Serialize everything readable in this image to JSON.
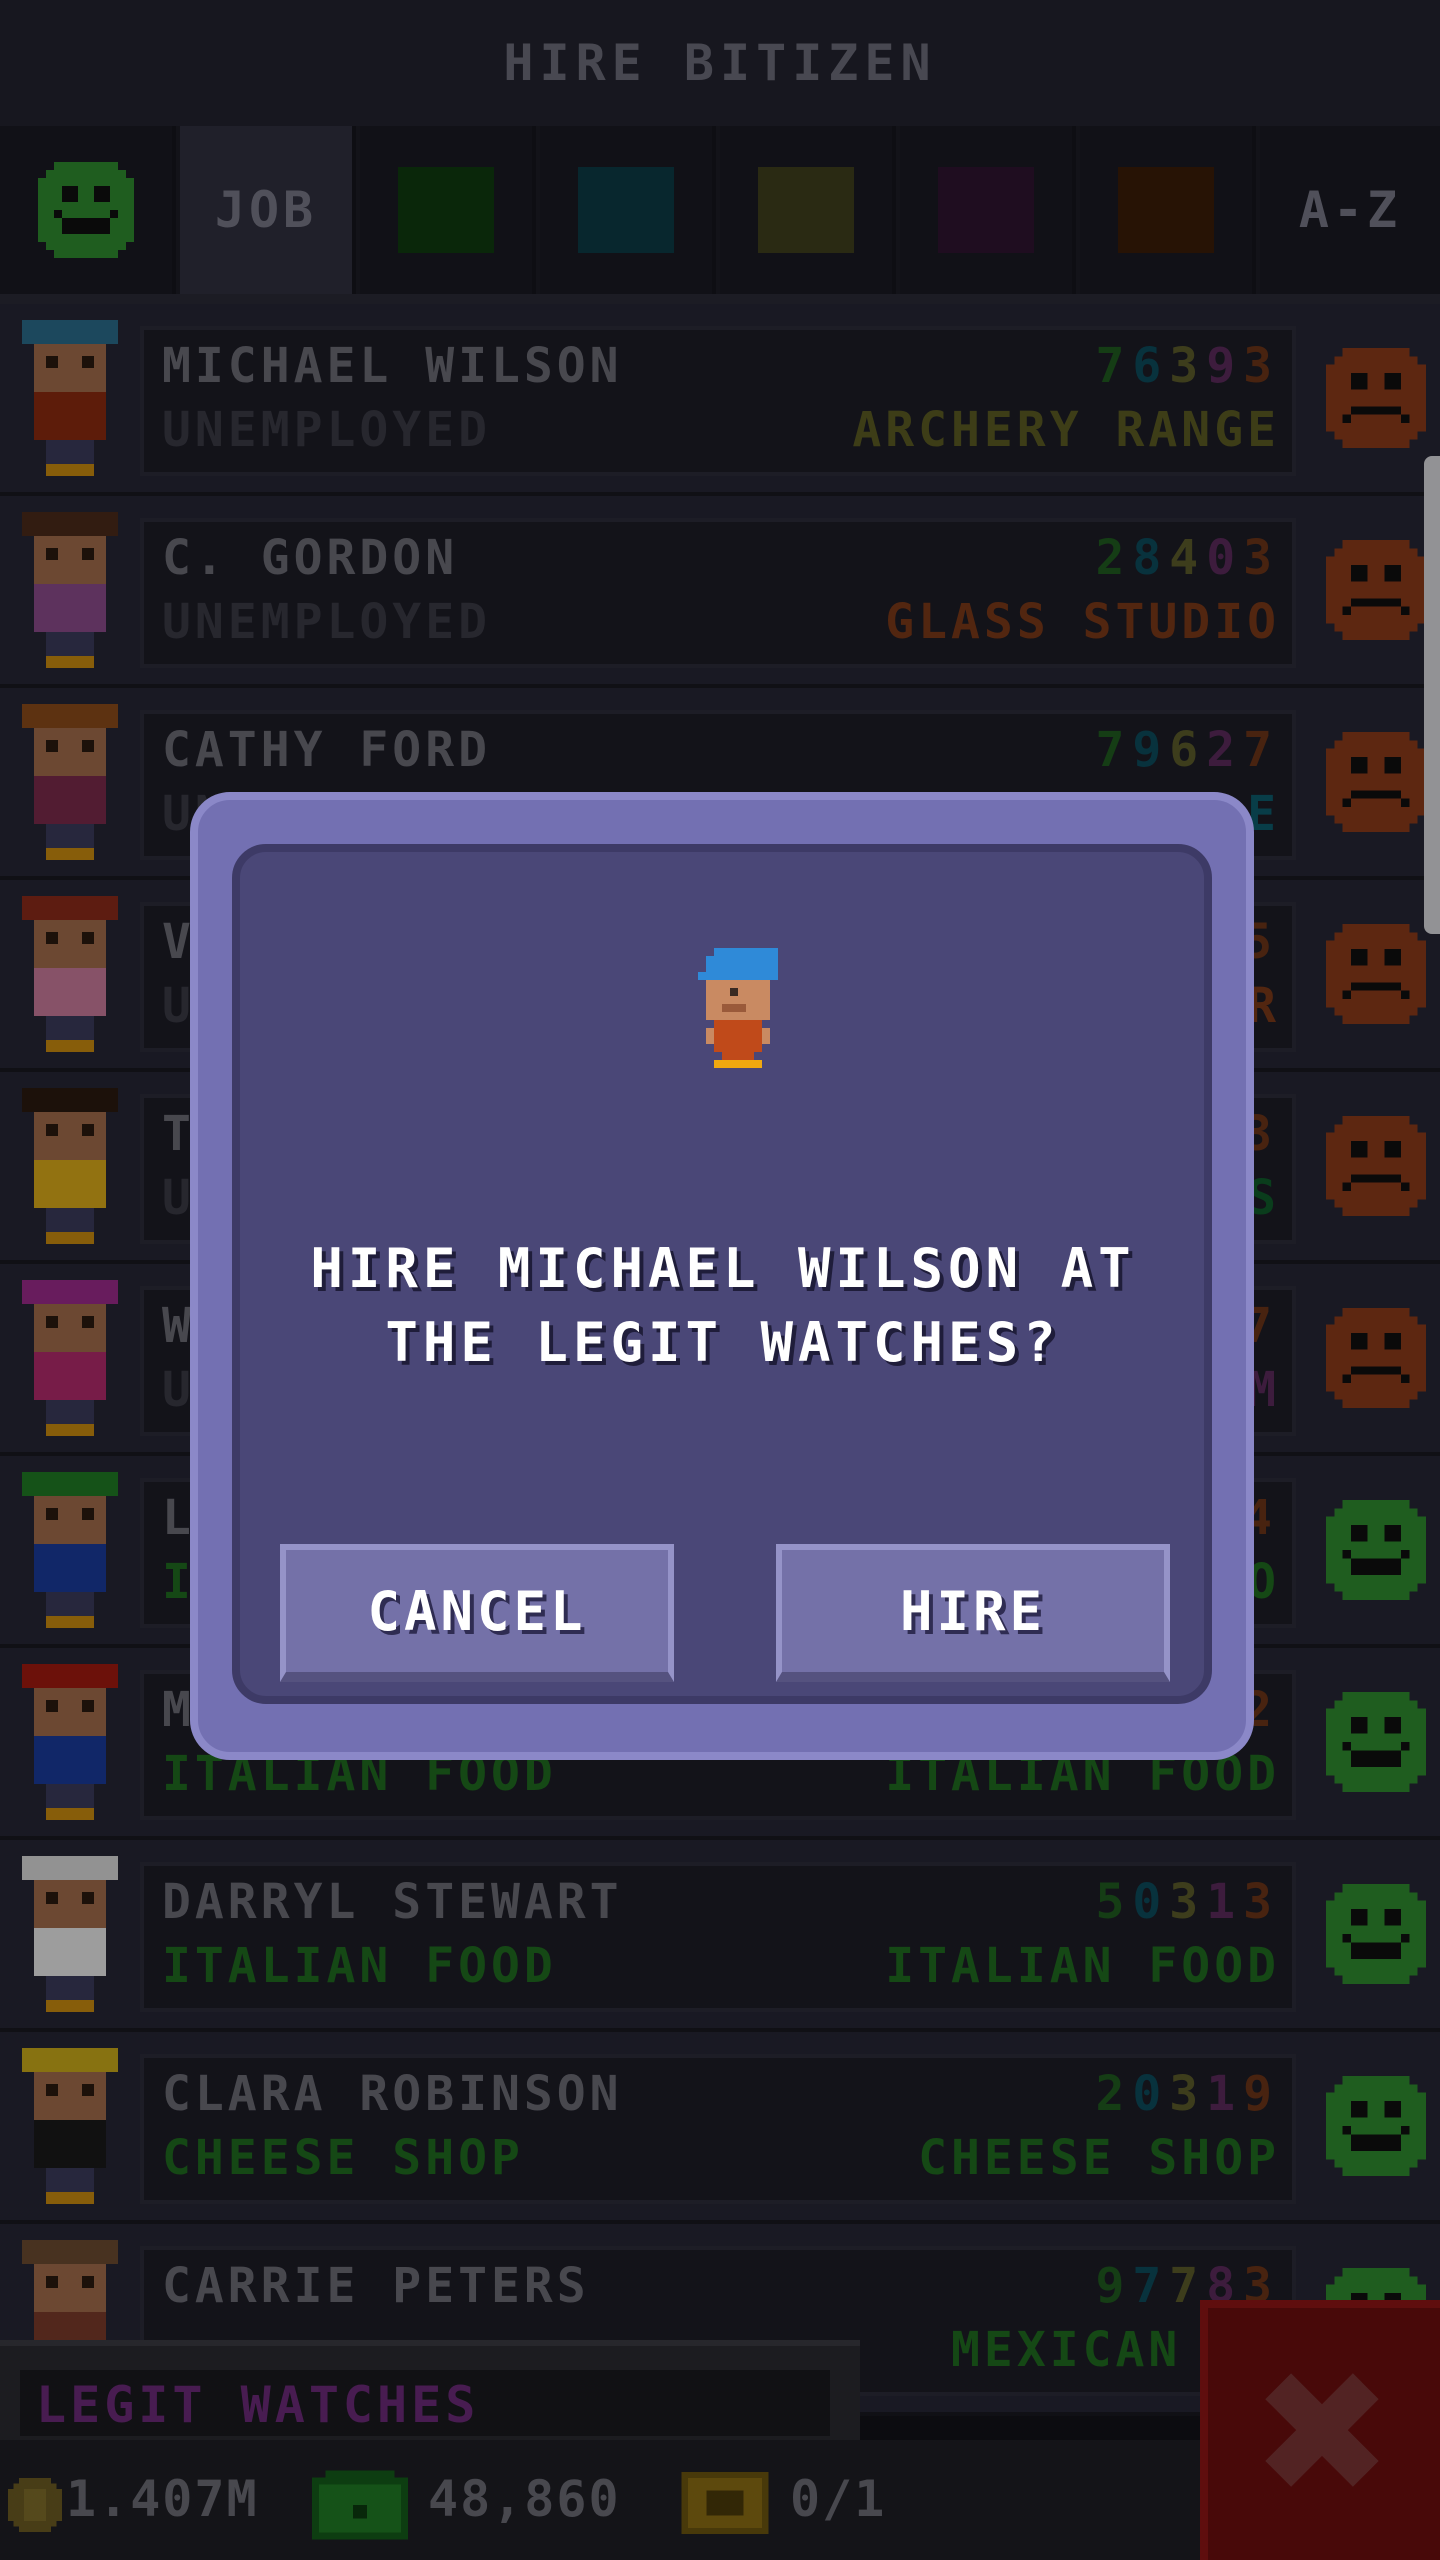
{
  "header": {
    "title": "HIRE BITIZEN"
  },
  "tabs": {
    "job_label": "JOB",
    "az_label": "A-Z",
    "colors": [
      "#0f3a0f",
      "#0c3a44",
      "#3e3e1c",
      "#2f1430",
      "#3a1c08"
    ]
  },
  "rows": [
    {
      "name": "MICHAEL WILSON",
      "job": "UNEMPLOYED",
      "dream": "ARCHERY RANGE",
      "stats": [
        "7",
        "6",
        "3",
        "9",
        "3"
      ],
      "job_color": "#3a3a44",
      "dream_color": "#5a5a22",
      "mood": "sad"
    },
    {
      "name": "C. GORDON",
      "job": "UNEMPLOYED",
      "dream": "GLASS STUDIO",
      "stats": [
        "2",
        "8",
        "4",
        "0",
        "3"
      ],
      "job_color": "#3a3a44",
      "dream_color": "#7a3818",
      "mood": "sad"
    },
    {
      "name": "CATHY FORD",
      "job": "UN",
      "dream": "E",
      "stats": [
        "7",
        "9",
        "6",
        "2",
        "7"
      ],
      "job_color": "#3a3a44",
      "dream_color": "#0c5a6a",
      "mood": "sad"
    },
    {
      "name": "V",
      "job": "U",
      "dream": "R",
      "stats": [
        "5"
      ],
      "job_color": "#3a3a44",
      "dream_color": "#7a3818",
      "mood": "sad"
    },
    {
      "name": "T",
      "job": "U",
      "dream": "S",
      "stats": [
        "3"
      ],
      "job_color": "#3a3a44",
      "dream_color": "#0f5a2a",
      "mood": "sad"
    },
    {
      "name": "W",
      "job": "U",
      "dream": "M",
      "stats": [
        "7"
      ],
      "job_color": "#3a3a44",
      "dream_color": "#5a2a5a",
      "mood": "sad"
    },
    {
      "name": "L",
      "job": "IT",
      "dream": "O",
      "stats": [
        "4"
      ],
      "job_color": "#1f6a1f",
      "dream_color": "#1f6a1f",
      "mood": "happy"
    },
    {
      "name": "M",
      "job": "ITALIAN FOOD",
      "dream": "ITALIAN FOOD",
      "stats": [
        "2"
      ],
      "job_color": "#1f6a1f",
      "dream_color": "#1f6a1f",
      "mood": "happy"
    },
    {
      "name": "DARRYL STEWART",
      "job": "ITALIAN FOOD",
      "dream": "ITALIAN FOOD",
      "stats": [
        "5",
        "0",
        "3",
        "1",
        "3"
      ],
      "job_color": "#1f6a1f",
      "dream_color": "#1f6a1f",
      "mood": "happy"
    },
    {
      "name": "CLARA ROBINSON",
      "job": "CHEESE SHOP",
      "dream": "CHEESE SHOP",
      "stats": [
        "2",
        "0",
        "3",
        "1",
        "9"
      ],
      "job_color": "#1f6a1f",
      "dream_color": "#1f6a1f",
      "mood": "happy"
    },
    {
      "name": "CARRIE PETERS",
      "job": "",
      "dream": "MEXICAN FO",
      "stats": [
        "9",
        "7",
        "7",
        "8",
        "3"
      ],
      "job_color": "#1f6a1f",
      "dream_color": "#1f6a1f",
      "mood": "happy"
    }
  ],
  "stat_colors": [
    "#1f5a1f",
    "#0c4a5a",
    "#5a5a2a",
    "#5a2a5a",
    "#6a3418"
  ],
  "footer": {
    "store_name": "LEGIT WATCHES",
    "coins": "1.407M",
    "bux": "48,860",
    "vip": "0/1"
  },
  "dialog": {
    "message": "HIRE MICHAEL WILSON AT THE LEGIT WATCHES?",
    "cancel_label": "CANCEL",
    "hire_label": "HIRE"
  }
}
